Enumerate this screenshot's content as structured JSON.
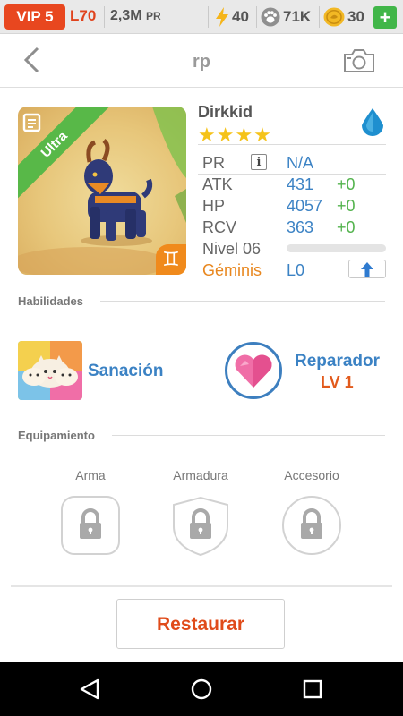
{
  "topbar": {
    "vip": "VIP 5",
    "level": "L70",
    "power_value": "2,3M",
    "power_unit": "PR",
    "energy": "40",
    "paws": "71K",
    "coins": "30",
    "plus": "+"
  },
  "header": {
    "title": "rp"
  },
  "monster": {
    "name": "Dirkkid",
    "rarity": "Ultra",
    "stars": "★★★★",
    "zodiac_glyph": "♊",
    "stats": {
      "pr_label": "PR",
      "pr_value": "N/A",
      "info": "i",
      "atk_label": "ATK",
      "atk_value": "431",
      "atk_plus": "+0",
      "hp_label": "HP",
      "hp_value": "4057",
      "hp_plus": "+0",
      "rcv_label": "RCV",
      "rcv_value": "363",
      "rcv_plus": "+0",
      "level_label": "Nivel 06",
      "sign_label": "Géminis",
      "sign_value": "L0"
    },
    "xp_progress": 0
  },
  "sections": {
    "abilities": "Habilidades",
    "equipment": "Equipamiento"
  },
  "abilities": {
    "skill_name": "Sanación",
    "leader_name": "Reparador",
    "leader_level": "LV 1"
  },
  "equipment": {
    "weapon": "Arma",
    "armor": "Armadura",
    "accessory": "Accesorio"
  },
  "actions": {
    "restore": "Restaurar"
  },
  "colors": {
    "accent": "#e8471f",
    "blue": "#3b82c4",
    "green": "#53b34d",
    "orange": "#e25a1c"
  }
}
